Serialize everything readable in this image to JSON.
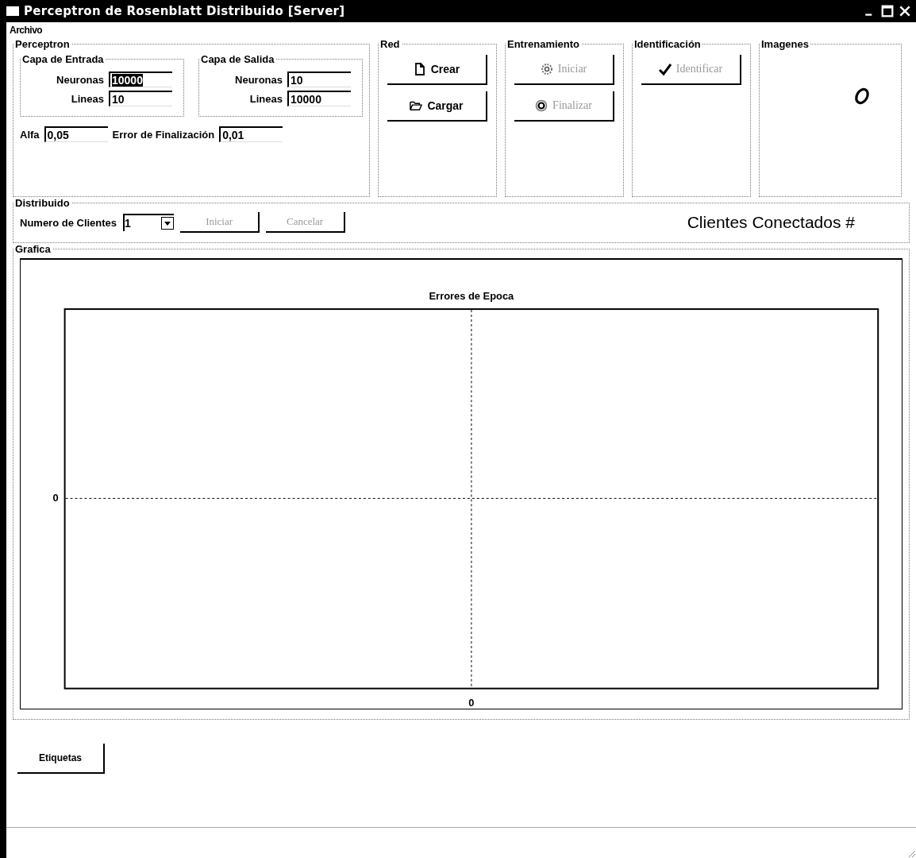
{
  "window": {
    "title": "Perceptron de Rosenblatt Distribuido [Server]"
  },
  "menu": [
    "Archivo"
  ],
  "perceptron": {
    "title": "Perceptron",
    "layers": [
      {
        "title": "Capa de Entrada",
        "fields": [
          {
            "label": "Neuronas",
            "value": "10000",
            "selected": true
          },
          {
            "label": "Lineas",
            "value": "10",
            "selected": false
          }
        ]
      },
      {
        "title": "Capa de Salida",
        "fields": [
          {
            "label": "Neuronas",
            "value": "10",
            "selected": false
          },
          {
            "label": "Lineas",
            "value": "10000",
            "selected": false
          }
        ]
      }
    ],
    "params": [
      {
        "label": "Alfa",
        "value": "0,05"
      },
      {
        "label": "Error de Finalización",
        "value": "0,01"
      }
    ]
  },
  "groups": [
    {
      "title": "Red",
      "kind": "buttons",
      "buttons": [
        {
          "label": "Crear",
          "disabled": false
        },
        {
          "label": "Cargar",
          "disabled": false
        }
      ]
    },
    {
      "title": "Entrenamiento",
      "kind": "buttons",
      "buttons": [
        {
          "label": "Iniciar",
          "disabled": true
        },
        {
          "label": "Finalizar",
          "disabled": true
        }
      ]
    },
    {
      "title": "Identificación",
      "kind": "buttons",
      "buttons": [
        {
          "label": "Identificar",
          "disabled": true
        }
      ]
    },
    {
      "title": "Imagenes"
    }
  ],
  "distribuido": {
    "title": "Distribuido",
    "label": "Numero de Clientes",
    "select": "1",
    "buttons": [
      {
        "label": "Iniciar",
        "disabled": true
      },
      {
        "label": "Cancelar",
        "disabled": true
      }
    ],
    "status": "Clientes Conectados #"
  },
  "grafica": {
    "title": "Grafica",
    "chart": {
      "title": "Errores de Epoca",
      "x_tick": "0",
      "y_tick": "0"
    }
  },
  "footer_button": "Etiquetas"
}
